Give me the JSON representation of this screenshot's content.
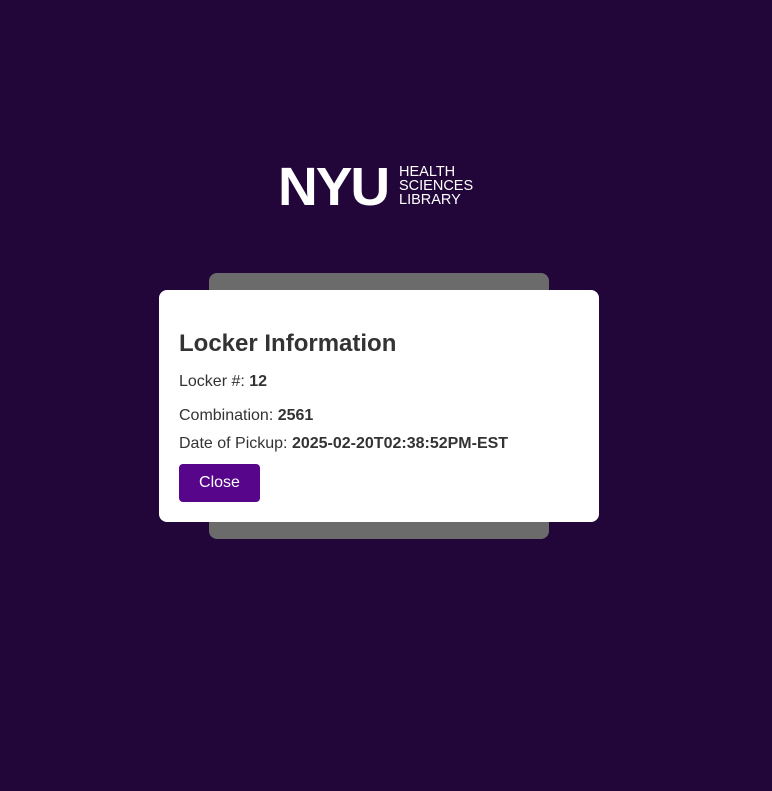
{
  "logo": {
    "main": "NYU",
    "sub_lines": [
      "HEALTH",
      "SCIENCES",
      "LIBRARY"
    ]
  },
  "modal": {
    "title": "Locker Information",
    "locker_label": "Locker #:",
    "locker_value": "12",
    "combination_label": "Combination:",
    "combination_value": "2561",
    "pickup_label": "Date of Pickup:",
    "pickup_value": "2025-02-20T02:38:52PM-EST",
    "close_label": "Close"
  },
  "colors": {
    "background": "#22063a",
    "accent": "#57068c",
    "backdrop_card": "#6b6b6b",
    "modal": "#ffffff",
    "text": "#333333"
  }
}
